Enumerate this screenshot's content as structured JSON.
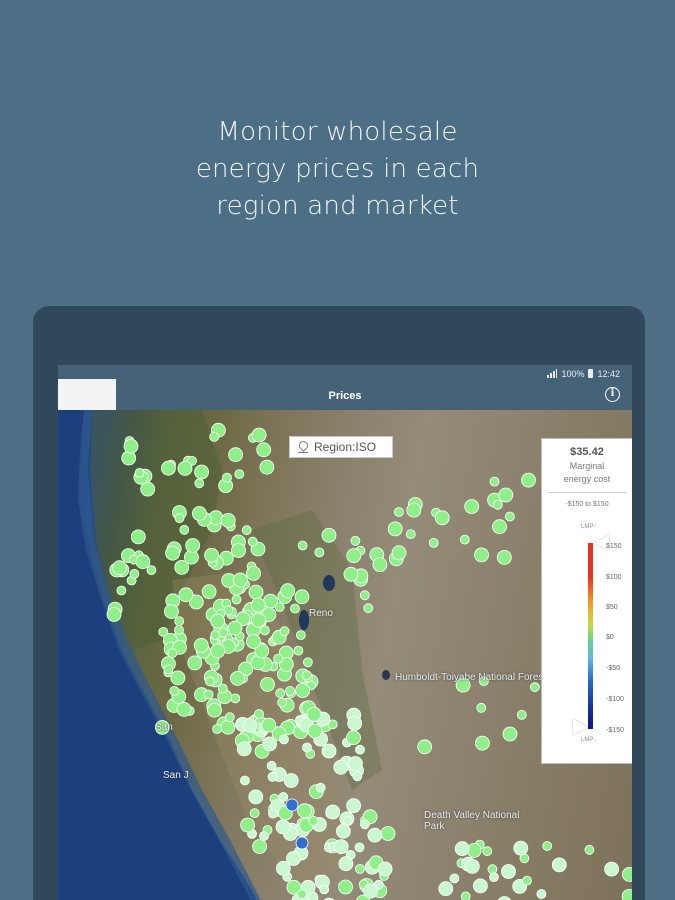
{
  "promo": {
    "line1": "Monitor wholesale",
    "line2": "energy prices in each",
    "line3": "region and market"
  },
  "status_bar": {
    "battery": "100%",
    "time": "12:42",
    "icons": [
      "signal-icon",
      "battery-icon"
    ]
  },
  "app_bar": {
    "title": "Prices",
    "info_icon": "info-icon"
  },
  "map": {
    "region_label": "Region:ISO",
    "region_icon": "pin-icon",
    "place_labels": [
      "Humboldt-Toiyabe National Forest",
      "Death Valley National Park",
      "Reno",
      "San",
      "San J"
    ]
  },
  "legend": {
    "price": "$35.42",
    "price_label_line1": "Marginal",
    "price_label_line2": "energy cost",
    "range": "-$150 to $150",
    "scale_top": "LMP↑",
    "scale_bottom": "LMP↓",
    "ticks": [
      "$150",
      "$100",
      "$50",
      "$0",
      "-$50",
      "-$100",
      "-$150"
    ],
    "colors": {
      "high": "#e8321e",
      "mid_high": "#f3a326",
      "mid": "#b7de4b",
      "zero": "#5fd38e",
      "low": "#2a66c6",
      "very_low": "#0e1a7e"
    }
  },
  "colors": {
    "background": "#4d6f86",
    "device_frame": "#31485a",
    "app_bar": "#466276",
    "node_green": "#8ff08a",
    "node_pale": "#c9f7cf",
    "node_blue": "#2f6fd0"
  }
}
